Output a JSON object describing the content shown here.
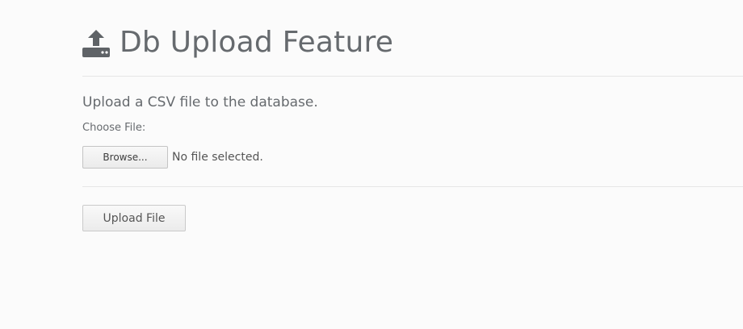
{
  "header": {
    "title": "Db Upload Feature",
    "icon": "upload-to-database-icon"
  },
  "form": {
    "subtitle": "Upload a CSV file to the database.",
    "file_label": "Choose File:",
    "browse_label": "Browse...",
    "file_status": "No file selected.",
    "upload_label": "Upload File"
  },
  "colors": {
    "text": "#666a6e",
    "background": "#fbfbfb",
    "divider": "#e6e6e6"
  }
}
